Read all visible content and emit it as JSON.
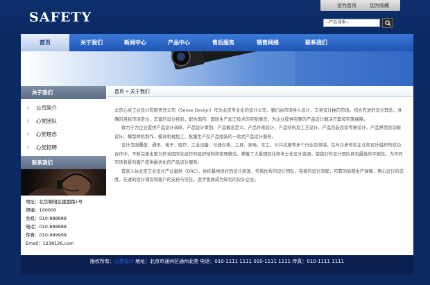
{
  "site": {
    "logo": "SAFETY"
  },
  "toplinks": {
    "home": "设为首页",
    "favorite": "加为收藏"
  },
  "search": {
    "placeholder": "--产品搜索--",
    "button": "搜"
  },
  "nav": {
    "items": [
      {
        "label": "首页"
      },
      {
        "label": "关于我们"
      },
      {
        "label": "新闻中心"
      },
      {
        "label": "产品中心"
      },
      {
        "label": "售后服务"
      },
      {
        "label": "销售网络"
      },
      {
        "label": "联系我们"
      }
    ]
  },
  "sidebar": {
    "title": "关于我们",
    "items": [
      {
        "label": "公司简介"
      },
      {
        "label": "心党团队"
      },
      {
        "label": "心党理念"
      },
      {
        "label": "心党招聘"
      }
    ],
    "contact_title": "联系我们",
    "contact_lines": [
      "地址：北京朝阳区建国路1号",
      "邮编：100000",
      "总机：010-888888",
      "电话：010-888888",
      "传真：010-999999",
      "Email：1238126.com"
    ]
  },
  "main": {
    "breadcrumb": "首页 » 关于我们",
    "paragraphs": [
      "北京心党工业设计有限责任公司（Sense Design）作为北京专业化的设计公司，我们由市场导入设计，又将设计推向市场。结合先进的设计理念，准确的目标市场定位，丰富的设计经验，配合国内、国际生产加工技术的实际情况，为企业提供完整的产品设计解决方案和实施保障。",
      "致力于为企业提供产品设计调研、产品设计策划、产品概念定义、产品外观设计、产品结构及工艺设计、产品包装及宣传册设计、产品界面及功能设计、模型样机制作、模具机械加工、批量生产及产品组装的一站式产品设计服务。",
      "设计范围覆盖：通讯、电子、医疗、工业设备、仪器仪表、工具、家电、军工、公共设施等多个行业及领域。在与众多知名企业和设计组织的成功合作中，不断完善出更为符合国际化运作的组织结构和管理模式。掌握了大量国际化和本土化设计资源，使我们的设计团队具有最佳的平衡性，为不同市场背景的客户提供最优化的产品设计服务。",
      "首家入住北京工业设计产业基地（DRC），依托基地良好的设计资源，凭借优秀的设计团队，完善的设计流程，可靠的后期生产保障，用心设计的态度，先进的设计理念和客户的支持与信任，逐步发展成为知名的设计企业。"
    ]
  },
  "footer": {
    "copyright_prefix": "版权所有：",
    "copyright_link": "心党设计",
    "address": "地址：北京市通州区通州北苑 电话：010-1111 1111  010-1111 1111  传真：010-1111 1111"
  },
  "colors": {
    "background": "#0b2a63",
    "nav": "#2a62c4",
    "accent": "#2b6cff"
  }
}
